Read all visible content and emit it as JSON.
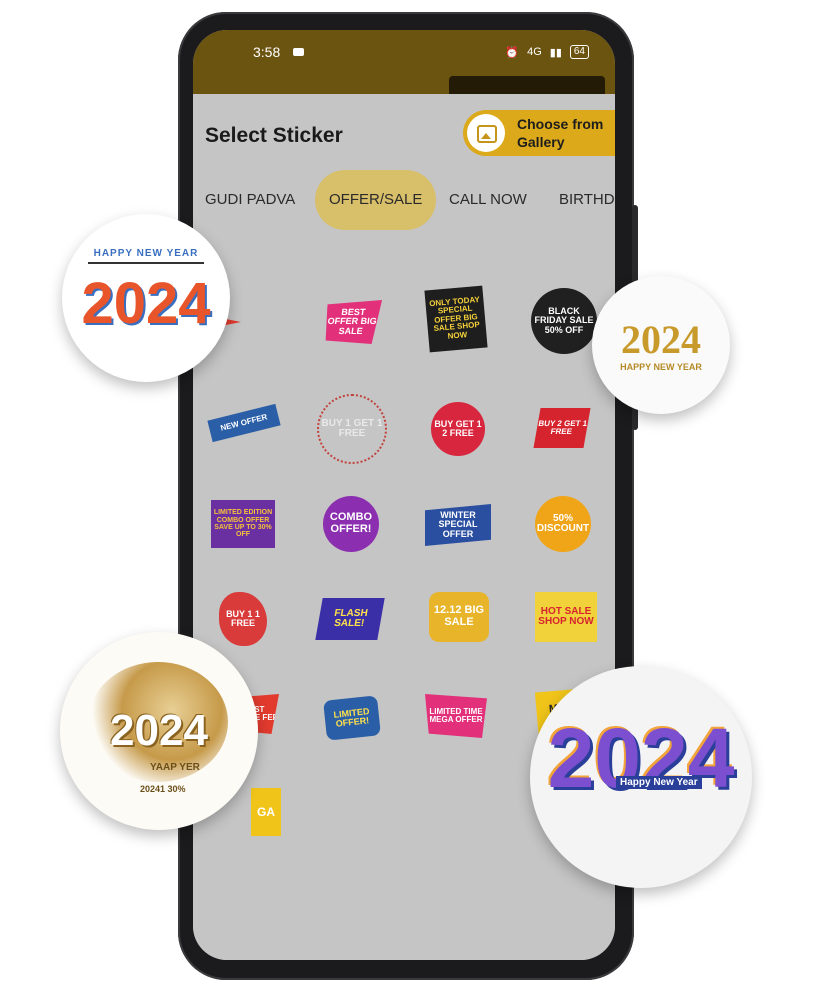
{
  "status_bar": {
    "time": "3:58",
    "network": "4G",
    "battery": "64"
  },
  "sheet": {
    "title": "Select Sticker",
    "gallery_button": "Choose from Gallery"
  },
  "tabs": [
    {
      "label": "GUDI PADVA",
      "active": false
    },
    {
      "label": "OFFER/SALE",
      "active": true
    },
    {
      "label": "CALL NOW",
      "active": false
    },
    {
      "label": "BIRTHD",
      "active": false
    }
  ],
  "stickers": [
    {
      "text": "",
      "bg": "#e23b2e"
    },
    {
      "text": "BEST OFFER BIG SALE",
      "bg": "#e2307a"
    },
    {
      "text": "ONLY TODAY SPECIAL OFFER BIG SALE SHOP NOW",
      "bg": "#1e1e1e"
    },
    {
      "text": "BLACK FRIDAY SALE 50% OFF",
      "bg": "#202020"
    },
    {
      "text": "NEW OFFER",
      "bg": "#2a5fa8"
    },
    {
      "text": "BUY 1 GET 1 FREE",
      "bg": "#ffffff"
    },
    {
      "text": "BUY GET 1 2 FREE",
      "bg": "#d7263d"
    },
    {
      "text": "BUY 2 GET 1 FREE",
      "bg": "#d6242f"
    },
    {
      "text": "LIMITED EDITION COMBO OFFER SAVE UP TO 30% OFF",
      "bg": "#6a2fa0"
    },
    {
      "text": "COMBO OFFER!",
      "bg": "#8b2fb0"
    },
    {
      "text": "WINTER SPECIAL OFFER",
      "bg": "#2a4fa0"
    },
    {
      "text": "50% DISCOUNT",
      "bg": "#f0a418"
    },
    {
      "text": "BUY 1 1 FREE",
      "bg": "#d93a3a"
    },
    {
      "text": "FLASH SALE!",
      "bg": "#3b2fa8"
    },
    {
      "text": "12.12 BIG SALE",
      "bg": "#e8b52a"
    },
    {
      "text": "HOT SALE SHOP NOW",
      "bg": "#f2d23a"
    },
    {
      "text": "LAST MINUTE FER",
      "bg": "#e23b2e"
    },
    {
      "text": "LIMITED OFFER!",
      "bg": "#2a5fa8"
    },
    {
      "text": "LIMITED TIME MEGA OFFER",
      "bg": "#e2307a"
    },
    {
      "text": "MEGA SALE",
      "bg": "#f0c419"
    },
    {
      "text": "GA",
      "bg": "#f0c419"
    }
  ],
  "badges": [
    {
      "line1": "HAPPY NEW YEAR",
      "line2": "2024"
    },
    {
      "line1": "2024",
      "line2": "HAPPY NEW YEAR"
    },
    {
      "line1": "2024",
      "line2": "YAAP YER",
      "line3": "20241 30%"
    },
    {
      "line1": "2024",
      "line2": "Happy New Year"
    }
  ],
  "colors": {
    "accent": "#dca91a",
    "tab_active": "#d8bf6a",
    "overlay": "#c5c5c5",
    "status_bar": "#6b5310"
  }
}
